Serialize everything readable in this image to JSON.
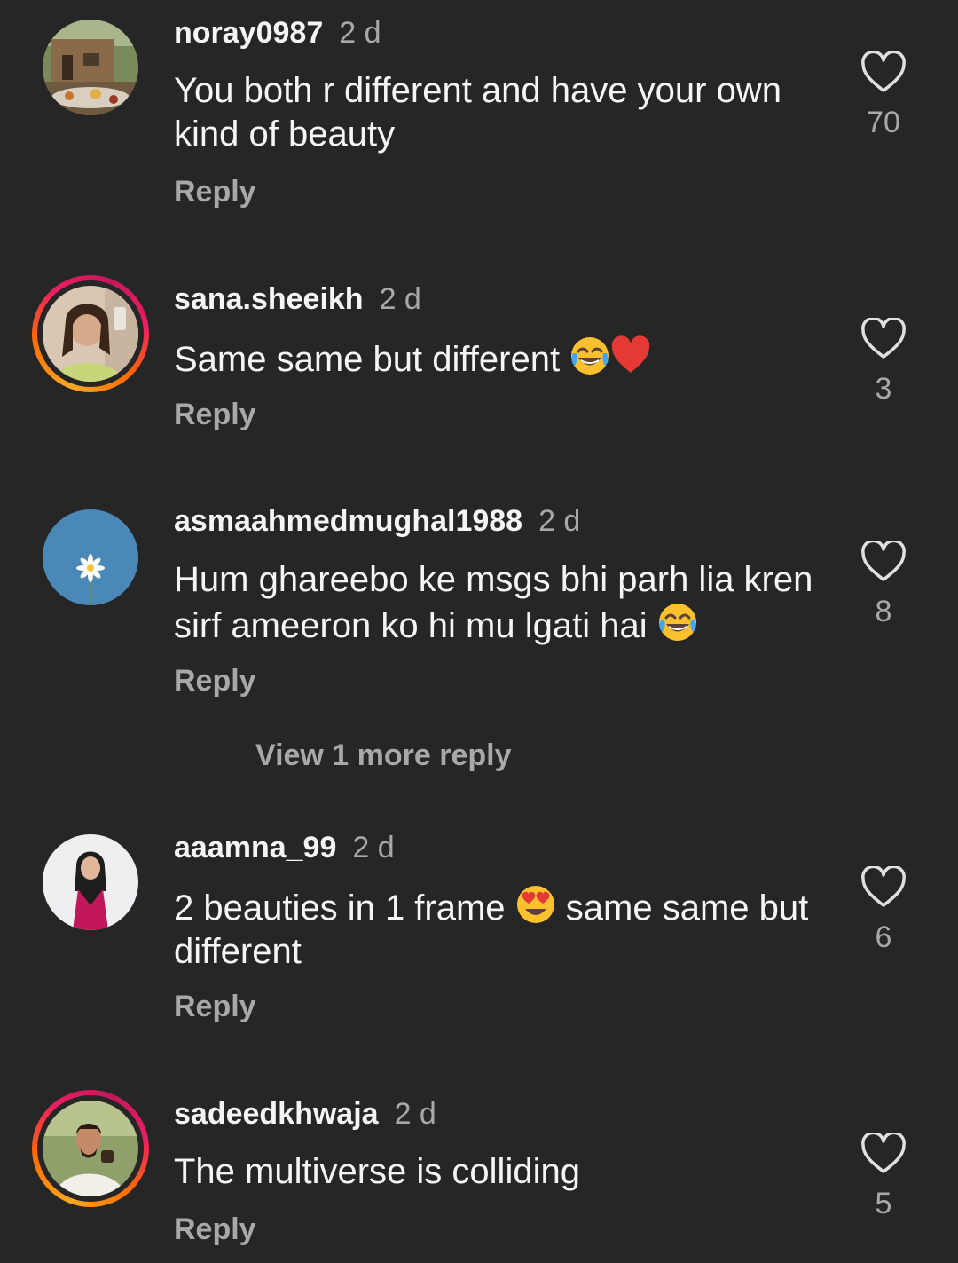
{
  "comments": [
    {
      "username": "noray0987",
      "time": "2 d",
      "text_before": "You both r different and have your own kind of beauty",
      "text_after": "",
      "emojis": [],
      "reply_label": "Reply",
      "likes": "70",
      "story_ring": false
    },
    {
      "username": "sana.sheeikh",
      "time": "2 d",
      "text_before": "Same same but different ",
      "text_after": "",
      "emojis": [
        "😂",
        "❤️"
      ],
      "reply_label": "Reply",
      "likes": "3",
      "story_ring": true
    },
    {
      "username": "asmaahmedmughal1988",
      "time": "2 d",
      "text_before": "Hum ghareebo ke msgs bhi parh lia kren sirf ameeron ko hi mu lgati hai ",
      "text_after": "",
      "emojis": [
        "😂"
      ],
      "reply_label": "Reply",
      "likes": "8",
      "story_ring": false
    },
    {
      "username": "aaamna_99",
      "time": "2 d",
      "text_before": "2 beauties in 1 frame ",
      "text_after": " same same but different",
      "emojis": [
        "😍"
      ],
      "reply_label": "Reply",
      "likes": "6",
      "story_ring": false
    },
    {
      "username": "sadeedkhwaja",
      "time": "2 d",
      "text_before": "The multiverse is colliding",
      "text_after": "",
      "emojis": [],
      "reply_label": "Reply",
      "likes": "5",
      "story_ring": true
    }
  ],
  "view_more_replies": "View 1 more reply",
  "icons": {
    "like": "heart-outline-icon",
    "laugh": "face-with-tears-of-joy-emoji",
    "heart": "red-heart-emoji",
    "heart_eyes": "heart-eyes-emoji"
  },
  "colors": {
    "background": "#262626",
    "primary_text": "#f5f5f5",
    "secondary_text": "#a8a8a8",
    "story_ring_start": "#f9a825",
    "story_ring_end": "#e91e63"
  }
}
